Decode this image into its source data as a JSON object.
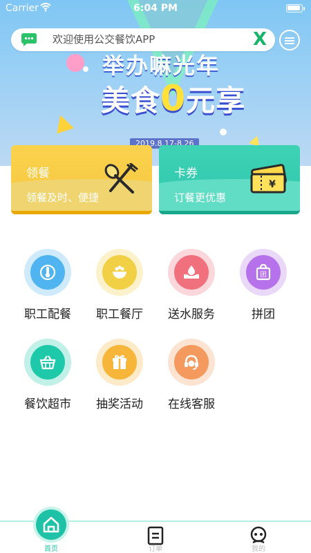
{
  "status_bar": {
    "carrier": "Carrier",
    "time": "6:04 PM"
  },
  "search": {
    "placeholder": "欢迎使用公交餐饮APP",
    "brand_letter": "X"
  },
  "banner": {
    "headline_line1": "举办嘛光年",
    "headline_prefix": "美食",
    "headline_zero": "0",
    "headline_suffix": "元享",
    "date_text": "2019.8.17-8.26"
  },
  "cards": [
    {
      "title": "领餐",
      "subtitle": "领餐及时、便捷",
      "icon": "fork-spoon-icon",
      "color": "#f8cc45"
    },
    {
      "title": "卡券",
      "subtitle": "订餐更优惠",
      "icon": "ticket-icon",
      "color": "#36cbb0"
    }
  ],
  "services": [
    {
      "label": "职工配餐",
      "icon": "thermometer-icon",
      "color": "#4fb4f0"
    },
    {
      "label": "职工餐厅",
      "icon": "rice-bowl-icon",
      "color": "#f2d046"
    },
    {
      "label": "送水服务",
      "icon": "water-hand-icon",
      "color": "#f0707e"
    },
    {
      "label": "拼团",
      "icon": "group-bag-icon",
      "color": "#b572ea"
    },
    {
      "label": "餐饮超市",
      "icon": "basket-icon",
      "color": "#1ec9a9"
    },
    {
      "label": "抽奖活动",
      "icon": "gift-icon",
      "color": "#f7b53a"
    },
    {
      "label": "在线客服",
      "icon": "headset-icon",
      "color": "#f59a5e"
    }
  ],
  "tabbar": {
    "items": [
      {
        "label": "首页",
        "icon": "home-icon",
        "active": true
      },
      {
        "label": "订单",
        "icon": "order-icon",
        "active": false
      },
      {
        "label": "我的",
        "icon": "profile-icon",
        "active": false
      }
    ],
    "accent": "#21c4a5"
  }
}
